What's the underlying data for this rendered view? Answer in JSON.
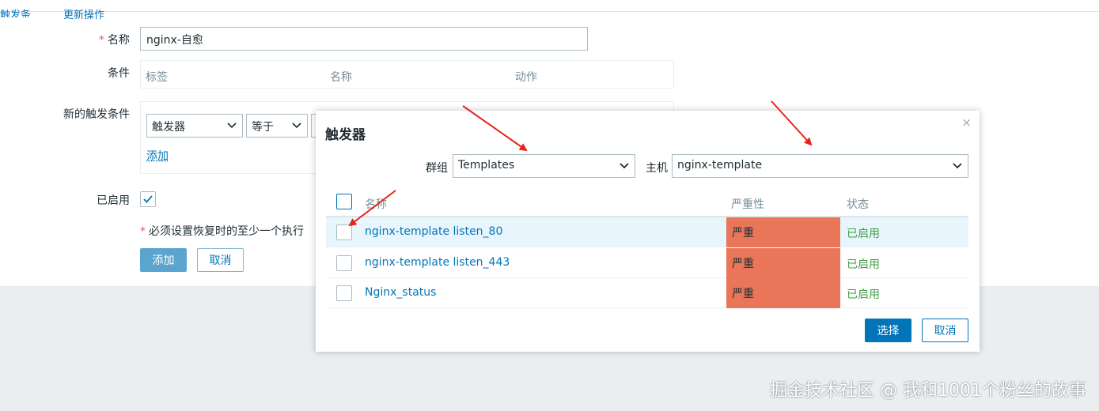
{
  "tabs": [
    "触发条件",
    "更新操作"
  ],
  "form": {
    "name_label": "名称",
    "name_required_mark": "*",
    "name_value": "nginx-自愈",
    "conditions_label": "条件",
    "conditions_headers": [
      "标签",
      "名称",
      "动作"
    ],
    "new_condition_label": "新的触发条件",
    "new_condition_type": "触发器",
    "new_condition_operator": "等于",
    "add_link": "添加",
    "enabled_label": "已启用",
    "enabled": true,
    "note_mark": "*",
    "note_text": "必须设置恢复时的至少一个执行",
    "add_button": "添加",
    "cancel_button": "取消"
  },
  "modal": {
    "title": "触发器",
    "close": "×",
    "group_label": "群组",
    "group_value": "Templates",
    "host_label": "主机",
    "host_value": "nginx-template",
    "columns": {
      "name": "名称",
      "severity": "严重性",
      "status": "状态"
    },
    "rows": [
      {
        "name": "nginx-template listen_80",
        "severity": "严重",
        "status": "已启用"
      },
      {
        "name": "nginx-template listen_443",
        "severity": "严重",
        "status": "已启用"
      },
      {
        "name": "Nginx_status",
        "severity": "严重",
        "status": "已启用"
      }
    ],
    "select_button": "选择",
    "cancel_button": "取消"
  },
  "colors": {
    "accent": "#0275b8",
    "severity_high": "#e97659",
    "status_enabled": "#429e47"
  },
  "watermark": "掘金技术社区 @ 我和1001个粉丝的故事"
}
